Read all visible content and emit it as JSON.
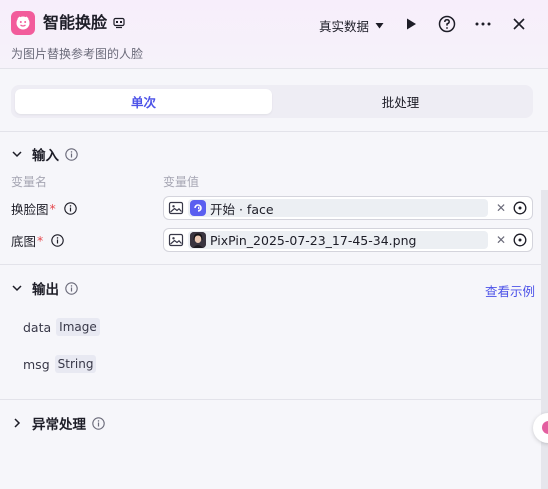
{
  "header": {
    "title": "智能换脸",
    "subtitle": "为图片替换参考图的人脸",
    "data_mode": "真实数据",
    "icon_names": [
      "face-node-icon",
      "badge-icon",
      "caret-down-icon",
      "play-icon",
      "help-icon",
      "more-icon",
      "close-icon"
    ]
  },
  "mode_tabs": [
    {
      "label": "单次",
      "active": true
    },
    {
      "label": "批处理",
      "active": false
    }
  ],
  "input_section": {
    "title": "输入",
    "col_name": "变量名",
    "col_value": "变量值",
    "params": [
      {
        "label": "换脸图",
        "required_mark": "*",
        "value": "开始 · face",
        "value_icon": "start-node-icon"
      },
      {
        "label": "底图",
        "required_mark": "*",
        "value": "PixPin_2025-07-23_17-45-34.png",
        "value_icon": "image-thumbnail"
      }
    ]
  },
  "output_section": {
    "title": "输出",
    "example_link": "查看示例",
    "fields": [
      {
        "name": "data",
        "type": "Image"
      },
      {
        "name": "msg",
        "type": "String"
      }
    ]
  },
  "exception_section": {
    "title": "异常处理"
  },
  "colors": {
    "accent": "#4d53e8",
    "node_icon": "#f25c9b",
    "required": "#e5484d"
  }
}
